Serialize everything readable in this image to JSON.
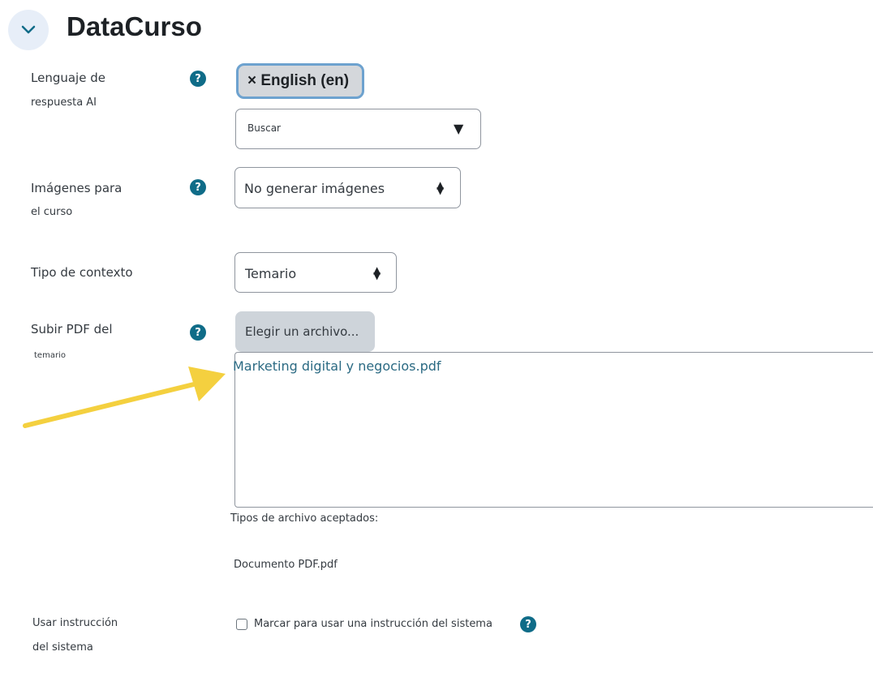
{
  "section": {
    "title": "DataCurso"
  },
  "fields": {
    "language": {
      "label_line1": "Lenguaje de",
      "label_line2": "respuesta AI",
      "chip_label": "× English (en)",
      "search_placeholder": "Buscar",
      "dropdown_arrow": "▼"
    },
    "images": {
      "label_line1": "Imágenes para",
      "label_line2": "el curso",
      "value": "No generar imágenes"
    },
    "context": {
      "label": "Tipo de contexto",
      "value": "Temario"
    },
    "pdf": {
      "label_line1": "Subir PDF del",
      "label_line2": "temario",
      "button_label": "Elegir un archivo...",
      "file_name": "Marketing digital y negocios.pdf",
      "accepted_label": "Tipos de archivo aceptados:",
      "accepted_value": "Documento PDF.pdf"
    },
    "system_instruction": {
      "label_line1": "Usar instrucción",
      "label_line2": "del sistema",
      "checkbox_label": "Marcar para usar una instrucción del sistema",
      "checked": false
    }
  },
  "help_icon_glyph": "?",
  "icons": [
    "chevron-down-icon",
    "help-icon",
    "sort-icon",
    "arrow-annotation"
  ],
  "colors": {
    "accent": "#0f6c88",
    "link": "#2b6a83",
    "arrow": "#f4d03f",
    "chip_border": "#6da2cf"
  }
}
